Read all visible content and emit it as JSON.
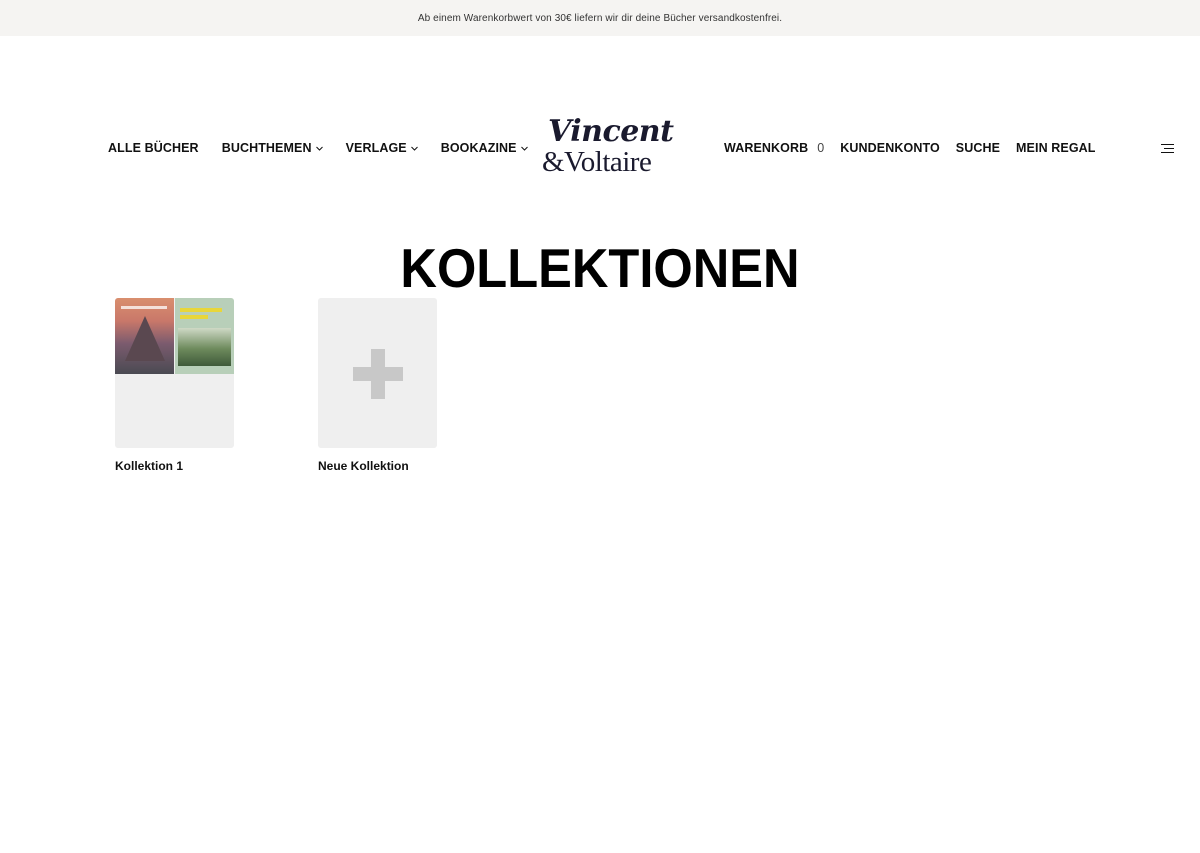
{
  "promo_bar": {
    "text": "Ab einem Warenkorbwert von 30€ liefern wir dir deine Bücher versandkostenfrei."
  },
  "header": {
    "nav_left": [
      {
        "label": "ALLE BÜCHER",
        "has_dropdown": false
      },
      {
        "label": "BUCHTHEMEN",
        "has_dropdown": true
      },
      {
        "label": "VERLAGE",
        "has_dropdown": true
      },
      {
        "label": "BOOKAZINE",
        "has_dropdown": true
      }
    ],
    "logo": {
      "line1": "Vincent",
      "line2": "&Voltaire"
    },
    "nav_right": {
      "cart_label": "WARENKORB",
      "cart_count": "0",
      "account_label": "KUNDENKONTO",
      "search_label": "SUCHE",
      "shelf_label": "MEIN REGAL"
    },
    "menu_icon": "hamburger-icon"
  },
  "main": {
    "title": "KOLLEKTIONEN",
    "collections": [
      {
        "label": "Kollektion 1",
        "type": "existing"
      },
      {
        "label": "Neue Kollektion",
        "type": "new",
        "icon": "plus-icon"
      }
    ]
  },
  "colors": {
    "promo_background": "#f5f4f2",
    "text": "#111111",
    "tile_background": "#efefef",
    "plus_icon": "#c8c8c8",
    "logo": "#1a1a2e"
  }
}
